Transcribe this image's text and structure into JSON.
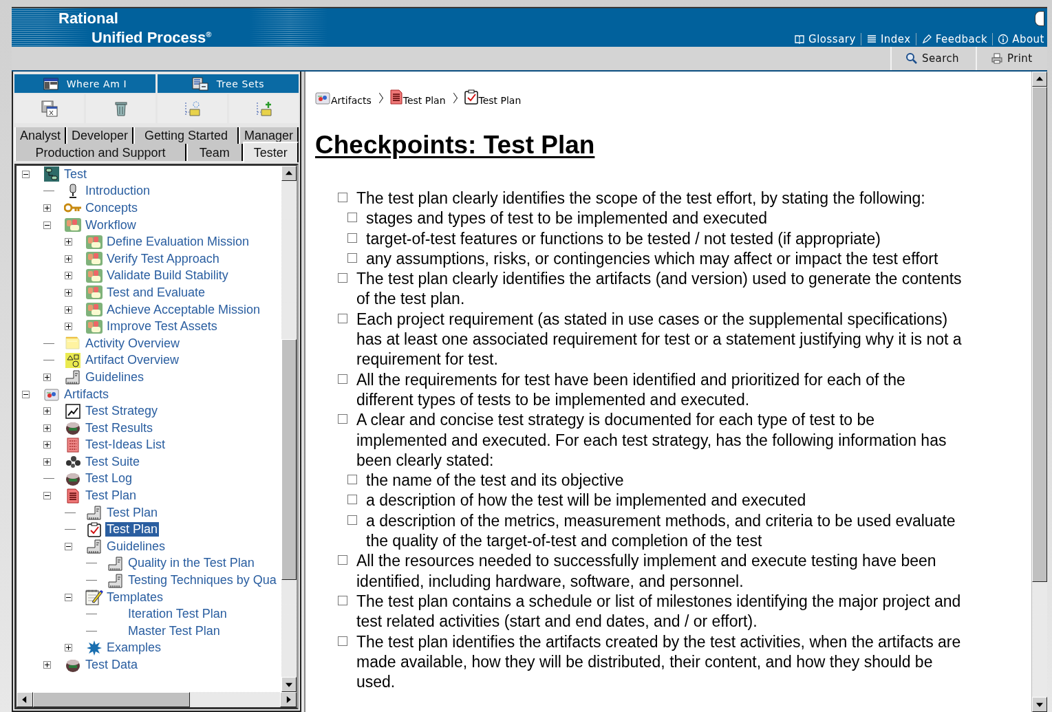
{
  "header": {
    "logo_line1": "Rational",
    "logo_line2": "Unified Process$^{®}$",
    "links": [
      {
        "label": "Glossary"
      },
      {
        "label": "Index"
      },
      {
        "label": "Feedback"
      },
      {
        "label": "About"
      }
    ]
  },
  "toolbar": {
    "buttons": [
      {
        "label": "Search"
      },
      {
        "label": "Print"
      }
    ]
  },
  "sidebar": {
    "view_tabs": [
      {
        "label": "Where Am I"
      },
      {
        "label": "Tree Sets"
      }
    ],
    "role_tab_rows": [
      [
        {
          "label": "Analyst",
          "selected": false
        },
        {
          "label": "Developer",
          "selected": false
        },
        {
          "label": "Getting Started",
          "selected": false
        },
        {
          "label": "Manager",
          "selected": false
        }
      ],
      [
        {
          "label": "Production and Support",
          "selected": false
        },
        {
          "label": "Team",
          "selected": false
        },
        {
          "label": "Tester",
          "selected": true
        }
      ]
    ],
    "tree": [
      {
        "label": "Test",
        "kind": "discipline",
        "expanded": true,
        "selected": false,
        "children": [
          {
            "label": "Introduction",
            "kind": "microphone",
            "selected": false
          },
          {
            "label": "Concepts",
            "kind": "key",
            "expanded": false,
            "selected": false
          },
          {
            "label": "Workflow",
            "kind": "workflow",
            "expanded": true,
            "selected": false,
            "children": [
              {
                "label": "Define Evaluation Mission",
                "kind": "workflow",
                "expanded": false,
                "selected": false
              },
              {
                "label": "Verify Test Approach",
                "kind": "workflow",
                "expanded": false,
                "selected": false
              },
              {
                "label": "Validate Build Stability",
                "kind": "workflow",
                "expanded": false,
                "selected": false
              },
              {
                "label": "Test and Evaluate",
                "kind": "workflow",
                "expanded": false,
                "selected": false
              },
              {
                "label": "Achieve Acceptable Mission",
                "kind": "workflow",
                "expanded": false,
                "selected": false
              },
              {
                "label": "Improve Test Assets",
                "kind": "workflow",
                "expanded": false,
                "selected": false
              }
            ]
          },
          {
            "label": "Activity Overview",
            "kind": "pages",
            "selected": false
          },
          {
            "label": "Artifact Overview",
            "kind": "shapes",
            "selected": false
          },
          {
            "label": "Guidelines",
            "kind": "ruler",
            "expanded": false,
            "selected": false
          }
        ]
      },
      {
        "label": "Artifacts",
        "kind": "artifacts",
        "expanded": true,
        "selected": false,
        "children": [
          {
            "label": "Test Strategy",
            "kind": "chart",
            "expanded": false,
            "selected": false
          },
          {
            "label": "Test Results",
            "kind": "drum",
            "expanded": false,
            "selected": false
          },
          {
            "label": "Test-Ideas List",
            "kind": "list",
            "expanded": false,
            "selected": false
          },
          {
            "label": "Test Suite",
            "kind": "cluster",
            "expanded": false,
            "selected": false
          },
          {
            "label": "Test Log",
            "kind": "drum",
            "selected": false
          },
          {
            "label": "Test Plan",
            "kind": "document",
            "expanded": true,
            "selected": false,
            "children": [
              {
                "label": "Test Plan",
                "kind": "ruler",
                "selected": false
              },
              {
                "label": "Test Plan",
                "kind": "checklist",
                "selected": true
              },
              {
                "label": "Guidelines",
                "kind": "ruler",
                "expanded": true,
                "selected": false,
                "children": [
                  {
                    "label": "Quality in the Test Plan",
                    "kind": "ruler",
                    "selected": false
                  },
                  {
                    "label": "Testing Techniques by Qua",
                    "kind": "ruler",
                    "selected": false
                  }
                ]
              },
              {
                "label": "Templates",
                "kind": "notepad",
                "expanded": true,
                "selected": false,
                "children": [
                  {
                    "label": "Iteration Test Plan",
                    "kind": "plain",
                    "selected": false
                  },
                  {
                    "label": "Master Test Plan",
                    "kind": "plain",
                    "selected": false
                  }
                ]
              },
              {
                "label": "Examples",
                "kind": "star",
                "expanded": false,
                "selected": false
              }
            ]
          },
          {
            "label": "Test Data",
            "kind": "drum",
            "expanded": false,
            "selected": false
          }
        ]
      }
    ]
  },
  "content": {
    "breadcrumb": [
      {
        "label": "Artifacts",
        "kind": "artifacts"
      },
      {
        "label": "Test Plan",
        "kind": "document"
      },
      {
        "label": "Test Plan",
        "kind": "checklist"
      }
    ],
    "title": "Checkpoints: Test Plan",
    "checkpoints": [
      {
        "text": "The test plan clearly identifies the scope of the test effort, by stating the following:",
        "checked": false,
        "children": [
          {
            "text": "stages and types of test to be implemented and executed",
            "checked": false
          },
          {
            "text": "target-of-test features or functions to be tested / not tested (if appropriate)",
            "checked": false
          },
          {
            "text": "any assumptions, risks, or contingencies which may affect or impact the test effort",
            "checked": false
          }
        ]
      },
      {
        "text": "The test plan clearly identifies the artifacts (and version) used to generate the contents of the test plan.",
        "checked": false
      },
      {
        "text": "Each project requirement (as stated in use cases or the supplemental specifications) has at least one associated requirement for test or a statement justifying why it is not a requirement for test.",
        "checked": false
      },
      {
        "text": "All the requirements for test have been identified and prioritized for each of the different types of tests to be implemented and executed.",
        "checked": false
      },
      {
        "text": "A clear and concise test strategy is documented for each type of test to be implemented and executed. For each test strategy, has the following information has been clearly stated:",
        "checked": false,
        "children": [
          {
            "text": "the name of the test and its objective",
            "checked": false
          },
          {
            "text": "a description of how the test will be implemented and executed",
            "checked": false
          },
          {
            "text": "a description of the metrics, measurement methods, and criteria to be used evaluate the quality of the target-of-test and completion of the test",
            "checked": false
          }
        ]
      },
      {
        "text": "All the resources needed to successfully implement and execute testing have been identified, including hardware, software, and personnel.",
        "checked": false
      },
      {
        "text": "The test plan contains a schedule or list of milestones identifying the major project and test related activities (start and end dates, and / or effort).",
        "checked": false
      },
      {
        "text": "The test plan identifies the artifacts created by the test activities, when the artifacts are made available, how they will be distributed, their content, and how they should be used.",
        "checked": false
      }
    ]
  }
}
